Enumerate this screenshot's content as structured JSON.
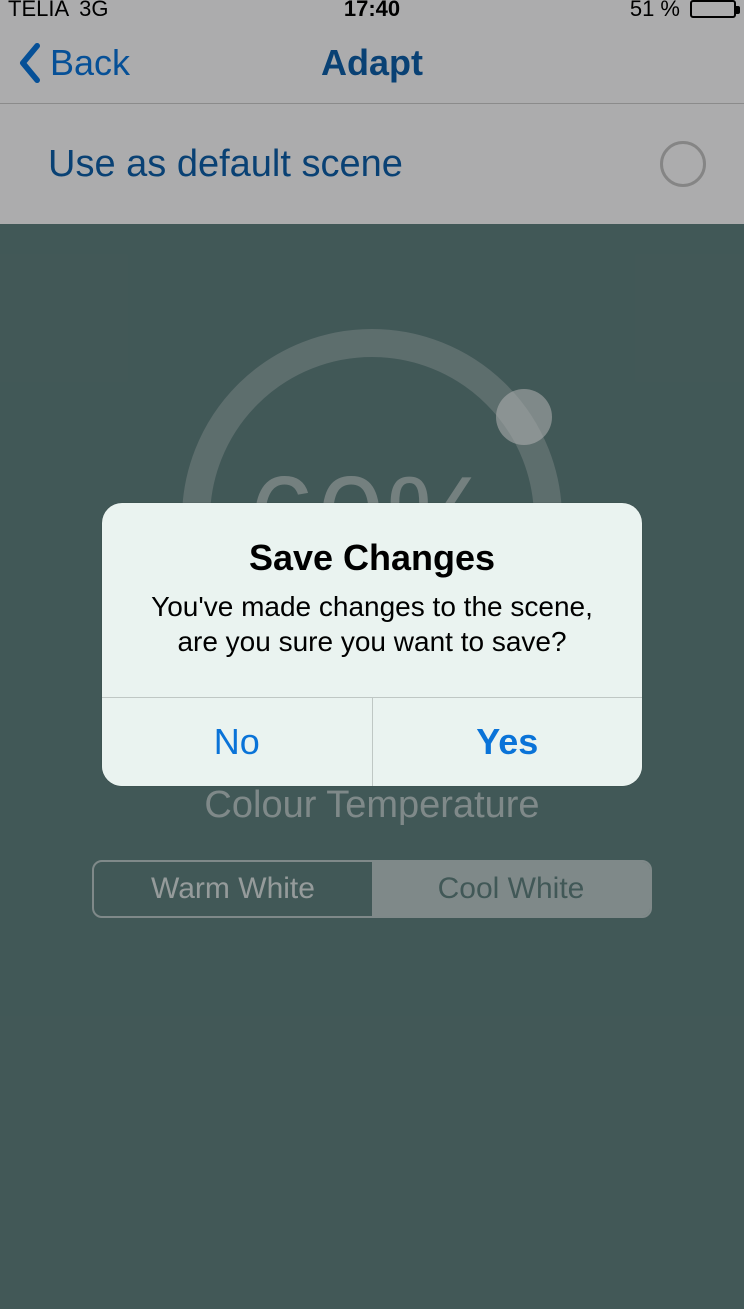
{
  "status_bar": {
    "carrier": "TELIA",
    "network": "3G",
    "time": "17:40",
    "battery_text": "51 %"
  },
  "nav": {
    "back_label": "Back",
    "title": "Adapt"
  },
  "default_row": {
    "label": "Use as default scene",
    "checked": false
  },
  "gauge": {
    "percent_text": "60%"
  },
  "colour_temp": {
    "label": "Colour Temperature",
    "segments": {
      "left": "Warm White",
      "right": "Cool White",
      "selected": "right"
    }
  },
  "alert": {
    "title": "Save Changes",
    "message": "You've made changes to the scene, are you sure you want to save?",
    "no_label": "No",
    "yes_label": "Yes"
  }
}
